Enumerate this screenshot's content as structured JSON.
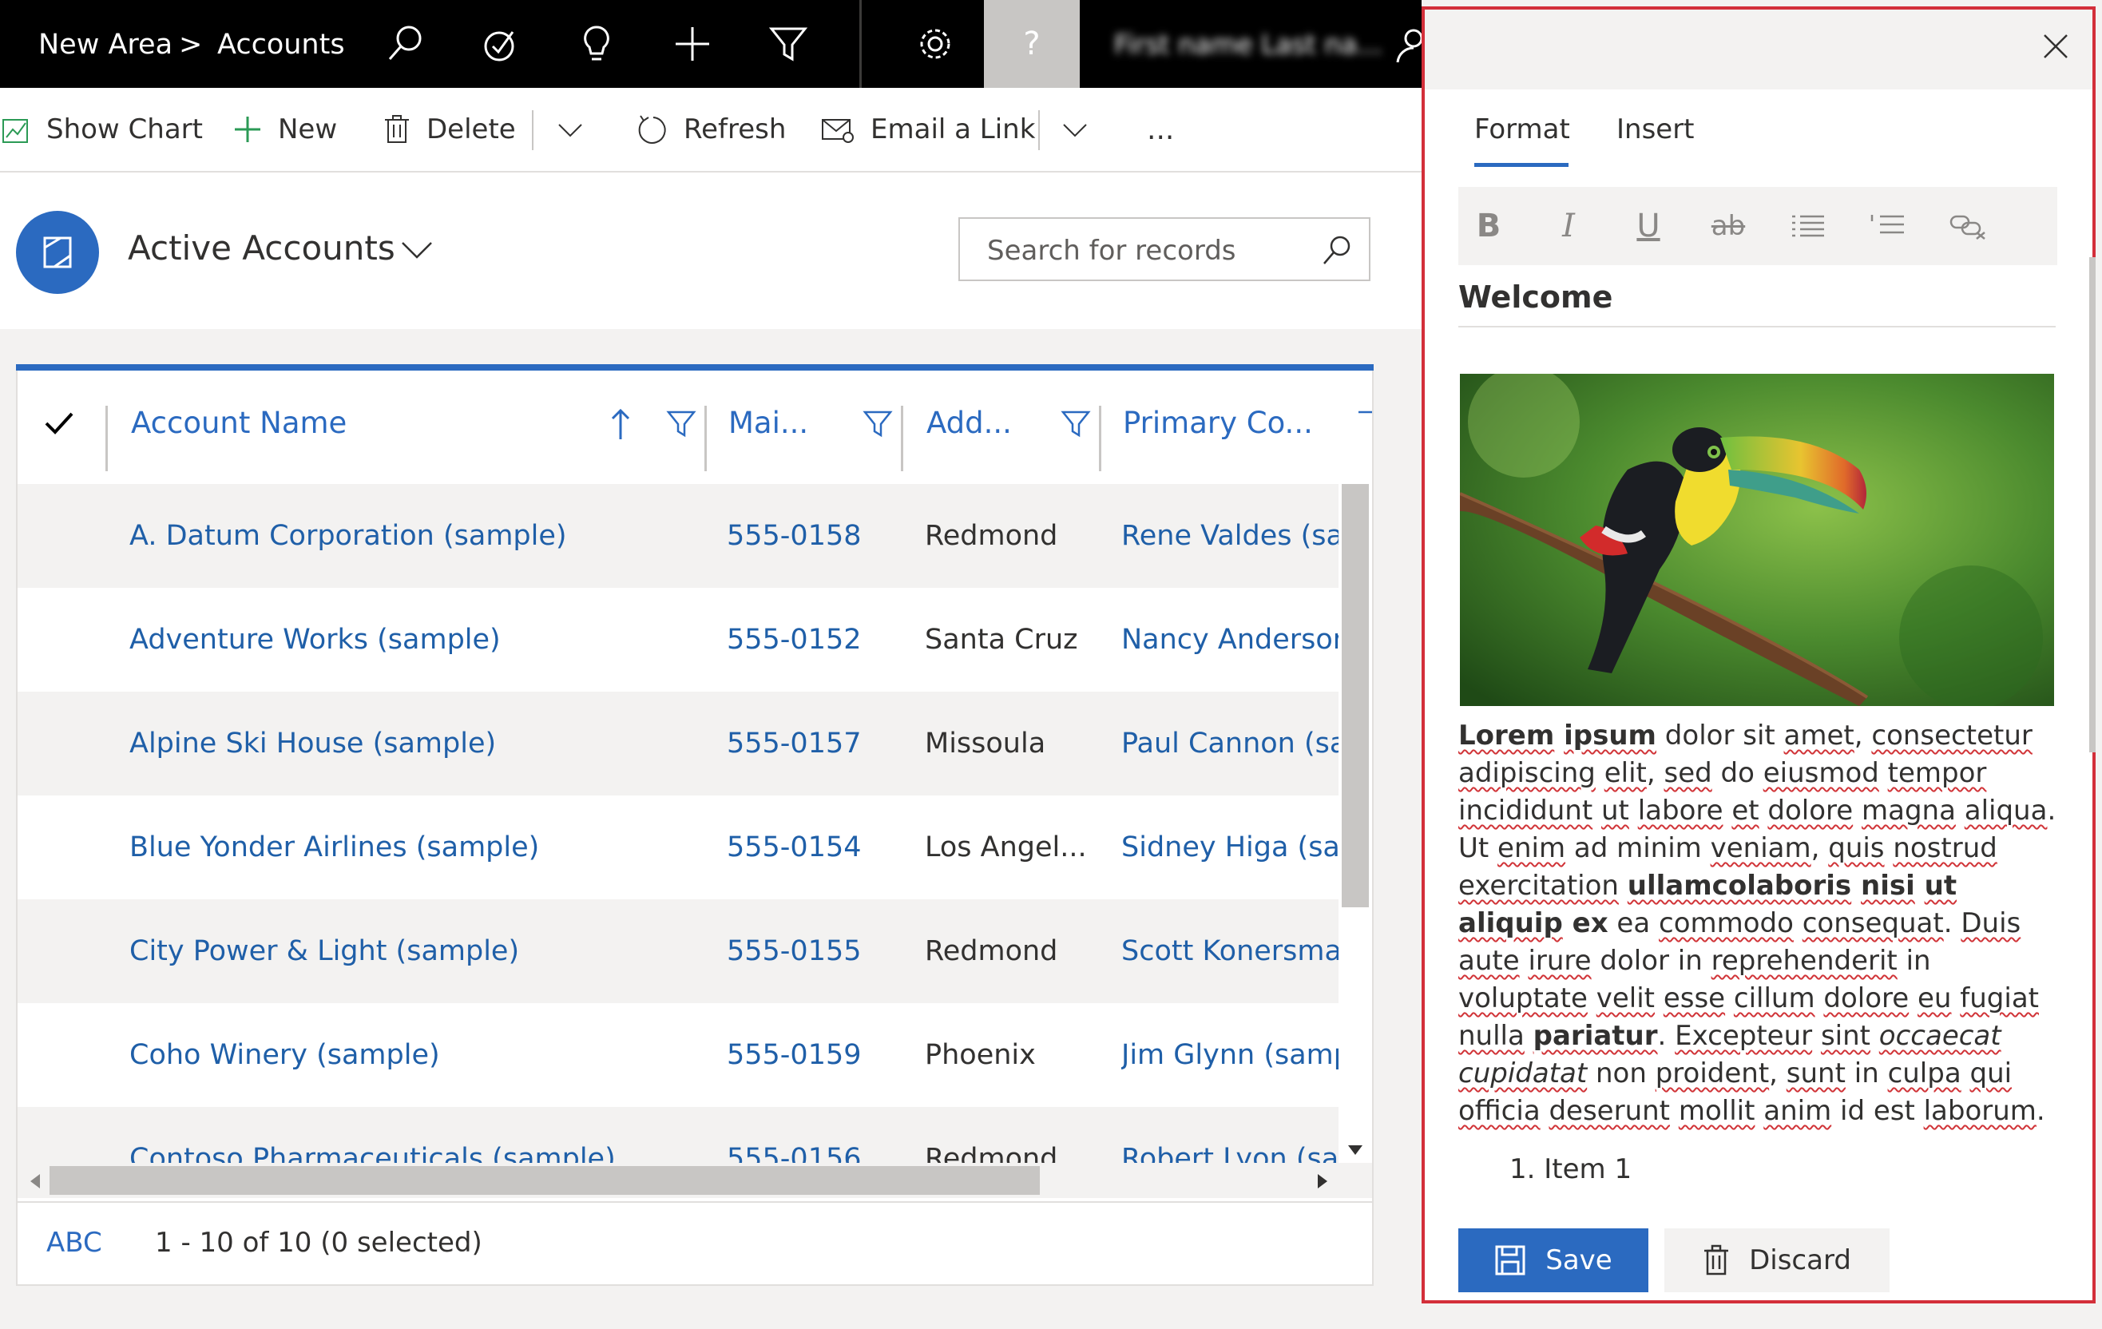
{
  "nav": {
    "area": "New Area",
    "separator": ">",
    "entity": "Accounts",
    "help": "?",
    "user_name": "First name Last na...",
    "icons": [
      "search-icon",
      "task-icon",
      "lightbulb-icon",
      "plus-icon",
      "filter-icon",
      "gear-icon",
      "help-icon",
      "person-icon"
    ]
  },
  "commands": {
    "show_chart": "Show Chart",
    "new": "New",
    "delete": "Delete",
    "refresh": "Refresh",
    "email_link": "Email a Link",
    "more": "..."
  },
  "view": {
    "title": "Active Accounts",
    "search_placeholder": "Search for records"
  },
  "grid": {
    "columns": [
      "Account Name",
      "Mai...",
      "Add...",
      "Primary Co..."
    ],
    "rows": [
      {
        "name": "A. Datum Corporation (sample)",
        "phone": "555-0158",
        "city": "Redmond",
        "contact": "Rene Valdes (sam"
      },
      {
        "name": "Adventure Works (sample)",
        "phone": "555-0152",
        "city": "Santa Cruz",
        "contact": "Nancy Anderson ("
      },
      {
        "name": "Alpine Ski House (sample)",
        "phone": "555-0157",
        "city": "Missoula",
        "contact": "Paul Cannon (sam"
      },
      {
        "name": "Blue Yonder Airlines (sample)",
        "phone": "555-0154",
        "city": "Los Angel...",
        "contact": "Sidney Higa (sam"
      },
      {
        "name": "City Power & Light (sample)",
        "phone": "555-0155",
        "city": "Redmond",
        "contact": "Scott Konersmanr"
      },
      {
        "name": "Coho Winery (sample)",
        "phone": "555-0159",
        "city": "Phoenix",
        "contact": "Jim Glynn (sample"
      },
      {
        "name": "Contoso Pharmaceuticals (sample)",
        "phone": "555-0156",
        "city": "Redmond",
        "contact": "Robert Lyon (sam"
      }
    ],
    "footer_abc": "ABC",
    "footer_count": "1 - 10 of 10 (0 selected)"
  },
  "panel": {
    "tabs": [
      "Format",
      "Insert"
    ],
    "active_tab": "Format",
    "heading": "Welcome",
    "list_item": "1. Item 1",
    "save": "Save",
    "discard": "Discard",
    "paragraph": "Lorem ipsum dolor sit amet, consectetur adipiscing elit, sed do eiusmod tempor incididunt ut labore et dolore magna aliqua. Ut enim ad minim veniam, quis nostrud exercitation ullamcolaboris nisi ut aliquip ex ea commodo consequat. Duis aute irure dolor in reprehenderit in voluptate velit esse cillum dolore eu fugiat nulla pariatur. Excepteur sint occaecat cupidatat non proident, sunt in culpa qui officia deserunt mollit anim id est laborum."
  },
  "colors": {
    "accent": "#2b6ac0",
    "topbar": "#000000",
    "panel_border": "#d32f3a",
    "spell_squiggle": "#d13438"
  }
}
